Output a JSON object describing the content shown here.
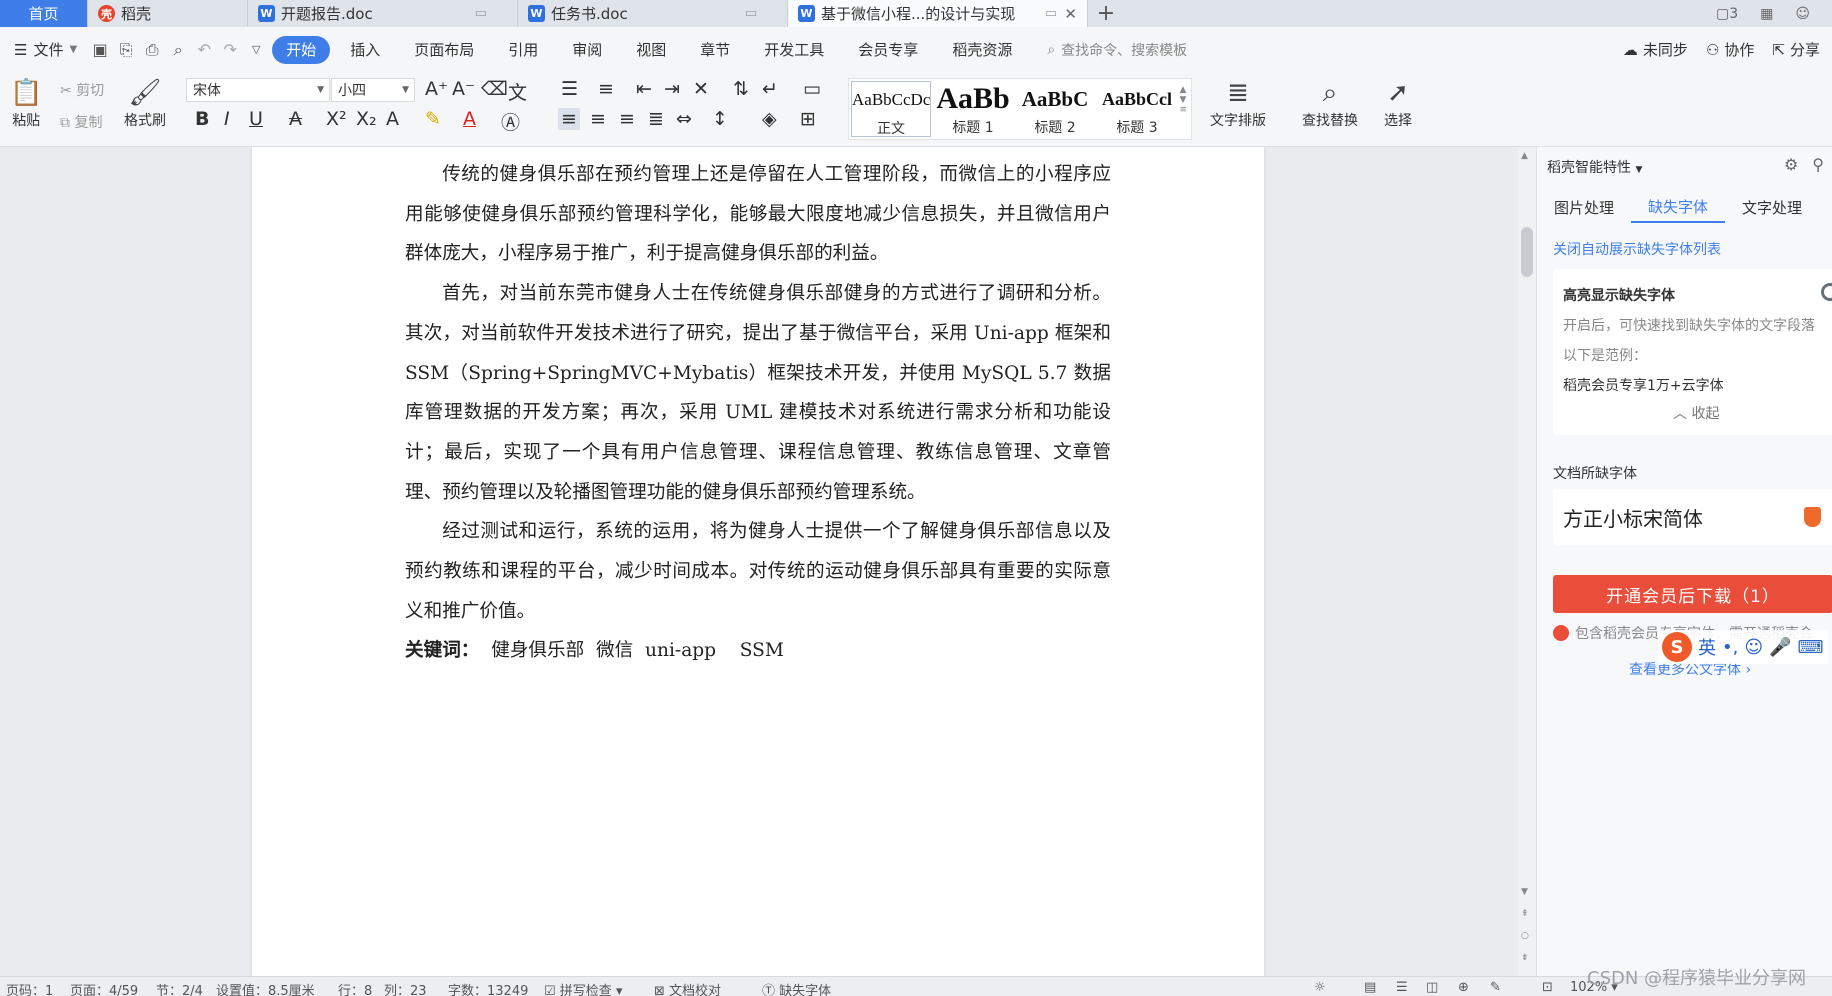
{
  "tabs": [
    {
      "label": "首页",
      "type": "home"
    },
    {
      "label": "稻壳",
      "type": "daoke"
    },
    {
      "label": "开题报告.doc",
      "type": "doc"
    },
    {
      "label": "任务书.doc",
      "type": "doc"
    },
    {
      "label": "基于微信小程...的设计与实现",
      "type": "doc",
      "active": true
    }
  ],
  "window_controls": [
    "3",
    "grid-icon",
    "avatar-icon"
  ],
  "menu": {
    "file_label": "文件",
    "items": [
      "开始",
      "插入",
      "页面布局",
      "引用",
      "审阅",
      "视图",
      "章节",
      "开发工具",
      "会员专享",
      "稻壳资源"
    ],
    "active_index": 0,
    "search_placeholder": "查找命令、搜索模板",
    "sync_label": "未同步",
    "collab_label": "协作",
    "share_label": "分享"
  },
  "ribbon": {
    "paste": "粘贴",
    "cut": "剪切",
    "copy": "复制",
    "format_painter": "格式刷",
    "font_name": "宋体",
    "font_size": "小四",
    "styles": [
      {
        "sample": "AaBbCcDc",
        "name": "正文"
      },
      {
        "sample": "AaBb",
        "name": "标题 1"
      },
      {
        "sample": "AaBbC",
        "name": "标题 2"
      },
      {
        "sample": "AaBbCcl",
        "name": "标题 3"
      }
    ],
    "text_layout": "文字排版",
    "find_replace": "查找替换",
    "select": "选择"
  },
  "document": {
    "paragraphs": [
      "传统的健身俱乐部在预约管理上还是停留在人工管理阶段，而微信上的小程序应用能够使健身俱乐部预约管理科学化，能够最大限度地减少信息损失，并且微信用户群体庞大，小程序易于推广，利于提高健身俱乐部的利益。",
      "首先，对当前东莞市健身人士在传统健身俱乐部健身的方式进行了调研和分析。其次，对当前软件开发技术进行了研究，提出了基于微信平台，采用 Uni-app 框架和 SSM（Spring+SpringMVC+Mybatis）框架技术开发，并使用 MySQL 5.7 数据库管理数据的开发方案；再次，采用 UML 建模技术对系统进行需求分析和功能设计；最后，实现了一个具有用户信息管理、课程信息管理、教练信息管理、文章管理、预约管理以及轮播图管理功能的健身俱乐部预约管理系统。",
      "经过测试和运行，系统的运用，将为健身人士提供一个了解健身俱乐部信息以及预约教练和课程的平台，减少时间成本。对传统的运动健身俱乐部具有重要的实际意义和推广价值。"
    ],
    "keywords_label": "关键词：",
    "keywords": "健身俱乐部  微信  uni-app    SSM"
  },
  "panel": {
    "title": "稻壳智能特性",
    "tabs": [
      "图片处理",
      "缺失字体",
      "文字处理"
    ],
    "active_tab": 1,
    "close_auto": "关闭自动展示缺失字体列表",
    "highlight_title": "高亮显示缺失字体",
    "highlight_desc": "开启后，可快速找到缺失字体的文字段落",
    "example_label": "以下是范例：",
    "example_text": "稻壳会员专享1万+云字体",
    "collapse": "收起",
    "missing_label": "文档所缺字体",
    "missing_font": "方正小标宋简体",
    "download_btn": "开通会员后下载（1）",
    "include_note": "包含稻壳会员专享字体，需开通稻壳会",
    "more_fonts": "查看更多公文字体",
    "ime": {
      "s": "S",
      "lang": "英"
    }
  },
  "status": {
    "page_code": "页码：1",
    "page": "页面：4/59",
    "section": "节：2/4",
    "setting": "设置值：8.5厘米",
    "row": "行：8",
    "col": "列：23",
    "words": "字数：13249",
    "spell": "拼写检查",
    "proof": "文档校对",
    "missing_font": "缺失字体",
    "zoom": "102%"
  },
  "watermark": "CSDN @程序猿毕业分享网"
}
